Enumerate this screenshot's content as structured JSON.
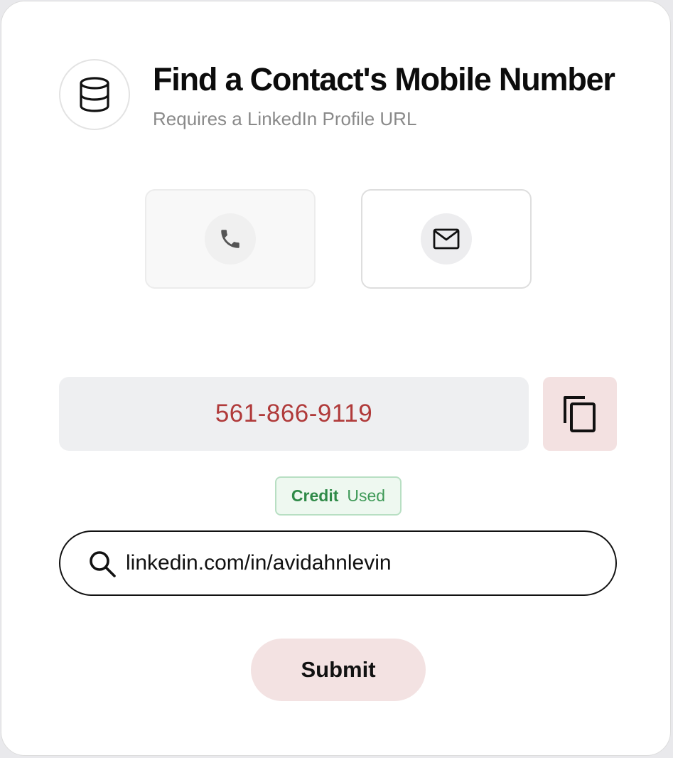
{
  "header": {
    "title": "Find a Contact's Mobile Number",
    "subtitle": "Requires a LinkedIn Profile URL",
    "icon": "database-icon"
  },
  "modes": [
    {
      "icon": "phone-icon",
      "selected": true
    },
    {
      "icon": "mail-icon",
      "selected": false
    }
  ],
  "result": {
    "value": "561-866-9119",
    "copy_icon": "copy-icon"
  },
  "badge": {
    "strong": "Credit",
    "light": "Used"
  },
  "search": {
    "value": "linkedin.com/in/avidahnlevin",
    "icon": "search-icon"
  },
  "submit": {
    "label": "Submit"
  },
  "colors": {
    "result_text": "#b03a3a",
    "accent_button": "#f3e2e2",
    "badge_green": "#2f8a48"
  }
}
